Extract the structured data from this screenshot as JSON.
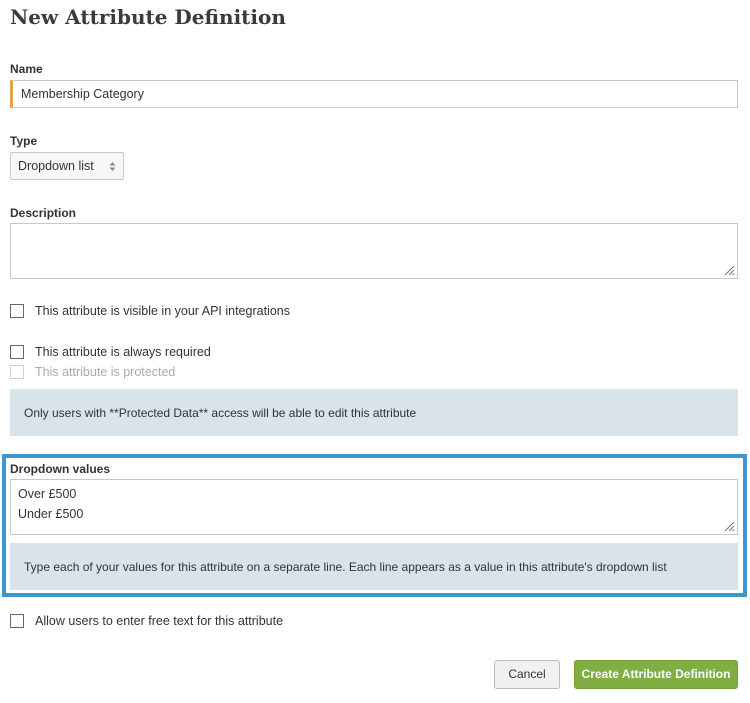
{
  "page": {
    "title": "New Attribute Definition"
  },
  "name_field": {
    "label": "Name",
    "value": "Membership Category"
  },
  "type_field": {
    "label": "Type",
    "selected": "Dropdown list"
  },
  "description_field": {
    "label": "Description",
    "value": ""
  },
  "checkboxes": {
    "api_visible": "This attribute is visible in your API integrations",
    "always_required": "This attribute is always required",
    "protected": "This attribute is protected"
  },
  "protected_note": "Only users with **Protected Data** access will be able to edit this attribute",
  "dropdown_values": {
    "label": "Dropdown values",
    "lines": [
      "Over £500",
      "Under £500"
    ],
    "help": "Type each of your values for this attribute on a separate line. Each line appears as a value in this attribute's dropdown list"
  },
  "free_text": "Allow users to enter free text for this attribute",
  "buttons": {
    "cancel": "Cancel",
    "create": "Create Attribute Definition"
  },
  "colors": {
    "highlight": "#3d97cc",
    "primary_button": "#7fae43",
    "input_accent": "#e3a24e",
    "note_bg": "#d8e3ea"
  }
}
